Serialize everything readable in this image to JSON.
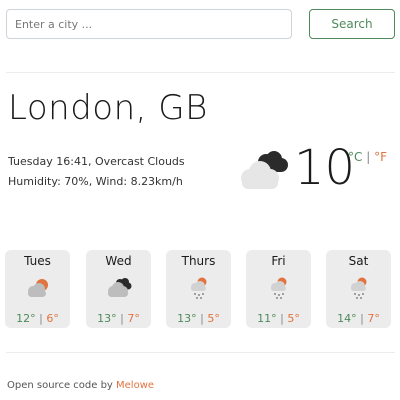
{
  "search": {
    "placeholder": "Enter a city ...",
    "value": "",
    "button_label": "Search"
  },
  "current": {
    "city": "London, GB",
    "datetime_condition": "Tuesday 16:41, Overcast Clouds",
    "humidity_wind": "Humidity: 70%, Wind: 8.23km/h",
    "temperature": "10",
    "icon": "overcast-clouds-icon",
    "unit_c": "°C",
    "unit_sep": "|",
    "unit_f": "°F"
  },
  "forecast": [
    {
      "day": "Tues",
      "high": "12°",
      "low": "6°",
      "icon": "sun-cloud-icon"
    },
    {
      "day": "Wed",
      "high": "13°",
      "low": "7°",
      "icon": "dark-clouds-icon"
    },
    {
      "day": "Thurs",
      "high": "13°",
      "low": "5°",
      "icon": "sun-rain-icon"
    },
    {
      "day": "Fri",
      "high": "11°",
      "low": "5°",
      "icon": "sun-rain-icon"
    },
    {
      "day": "Sat",
      "high": "14°",
      "low": "7°",
      "icon": "sun-rain-icon"
    }
  ],
  "temp_sep": "|",
  "footer": {
    "text": "Open source code by ",
    "link": "Melowe"
  },
  "colors": {
    "accent_green": "#4d8a5c",
    "accent_orange": "#e0733e",
    "card_bg": "#ececec"
  }
}
